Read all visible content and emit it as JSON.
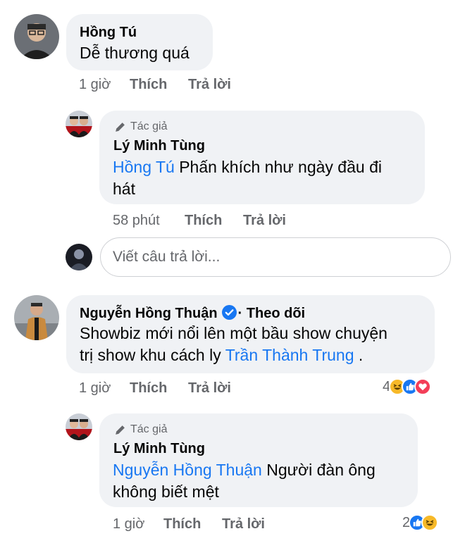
{
  "comments": [
    {
      "author": "Hồng Tú",
      "text": "Dễ thương quá",
      "time": "1 giờ",
      "like_label": "Thích",
      "reply_label": "Trả lời"
    },
    {
      "author_tag": "Tác giả",
      "author": "Lý Minh Tùng",
      "mention": "Hồng Tú",
      "text_line1": "Phấn khích như ngày đầu đi",
      "text_line2": "hát",
      "time": "58 phút",
      "like_label": "Thích",
      "reply_label": "Trả lời"
    },
    {
      "author": "Nguyễn Hồng Thuận",
      "follow_sep": "·",
      "follow_label": "Theo dõi",
      "text_line1": "Showbiz mới nổi lên một bầu show chuyện",
      "text_line2_prefix": "trị show khu cách ly",
      "mention": "Trần Thành Trung",
      "text_line2_suffix": ".",
      "time": "1 giờ",
      "like_label": "Thích",
      "reply_label": "Trả lời",
      "reaction_count": "4",
      "reaction_icons": [
        "haha-icon",
        "like-icon",
        "love-icon"
      ]
    },
    {
      "author_tag": "Tác giả",
      "author": "Lý Minh Tùng",
      "mention": "Nguyễn Hồng Thuận",
      "text_line1": "Người đàn ông",
      "text_line2": "không biết mệt",
      "time": "1 giờ",
      "like_label": "Thích",
      "reply_label": "Trả lời",
      "reaction_count": "2",
      "reaction_icons": [
        "like-icon",
        "haha-icon"
      ]
    }
  ],
  "reply_box": {
    "placeholder": "Viết câu trả lời..."
  },
  "colors": {
    "bubble": "#f0f2f5",
    "mention": "#1877f2",
    "secondary_text": "#65676b",
    "like_blue": "#1877f2",
    "love_red": "#f33e58",
    "haha_yellow": "#f7b928"
  }
}
